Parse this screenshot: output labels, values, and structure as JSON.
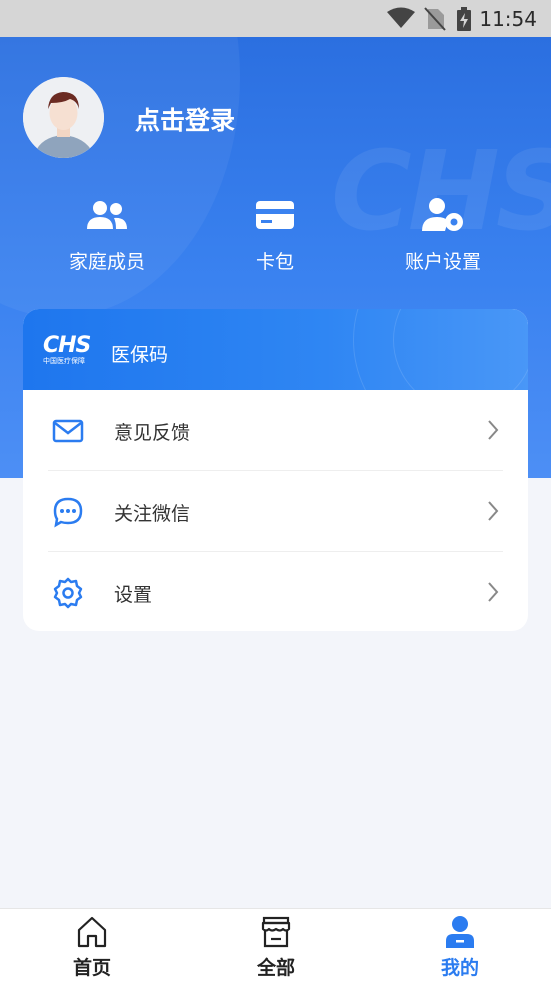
{
  "status_bar": {
    "time": "11:54"
  },
  "profile": {
    "login_label": "点击登录"
  },
  "quick_actions": [
    {
      "label": "家庭成员",
      "icon": "family-members-icon"
    },
    {
      "label": "卡包",
      "icon": "card-wallet-icon"
    },
    {
      "label": "账户设置",
      "icon": "account-settings-icon"
    }
  ],
  "insurance_card": {
    "title": "医保码",
    "logo_text": "CHS",
    "logo_subtitle": "中国医疗保障"
  },
  "menu": [
    {
      "label": "意见反馈",
      "icon": "mail-icon"
    },
    {
      "label": "关注微信",
      "icon": "chat-bubble-icon"
    },
    {
      "label": "设置",
      "icon": "gear-icon"
    }
  ],
  "bottom_nav": [
    {
      "label": "首页",
      "icon": "home-icon",
      "active": false
    },
    {
      "label": "全部",
      "icon": "store-icon",
      "active": false
    },
    {
      "label": "我的",
      "icon": "user-icon",
      "active": true
    }
  ],
  "colors": {
    "primary": "#2b7cf0",
    "header_gradient_start": "#2b6fe0",
    "background": "#f3f5fa"
  }
}
